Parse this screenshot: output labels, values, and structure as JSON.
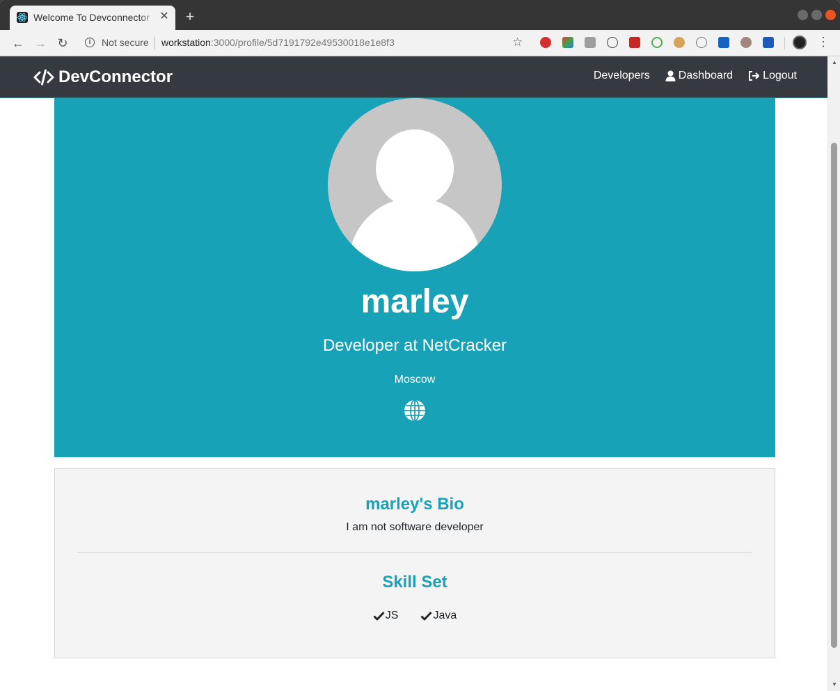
{
  "browser": {
    "tab_title": "Welcome To Devconnector",
    "tab_close": "✕",
    "new_tab": "+",
    "security_label": "Not secure",
    "url_host": "workstation",
    "url_rest": ":3000/profile/5d7191792e49530018e1e8f3",
    "extension_icons": [
      "abp-icon",
      "color-picker-icon",
      "js-icon",
      "braces-icon",
      "puzzle-icon",
      "target-icon",
      "cookie-icon",
      "link-icon",
      "lt-icon",
      "monkey-icon",
      "save-icon"
    ]
  },
  "navbar": {
    "brand": "DevConnector",
    "links": {
      "developers": "Developers",
      "dashboard": "Dashboard",
      "logout": "Logout"
    }
  },
  "profile": {
    "name": "marley",
    "title": "Developer at NetCracker",
    "location": "Moscow"
  },
  "about": {
    "bio_heading": "marley's Bio",
    "bio": "I am not software developer",
    "skills_heading": "Skill Set",
    "skills": [
      "JS",
      "Java"
    ]
  },
  "colors": {
    "primary": "#17a2b8",
    "navbar": "#343a40",
    "light": "#f4f4f4"
  }
}
